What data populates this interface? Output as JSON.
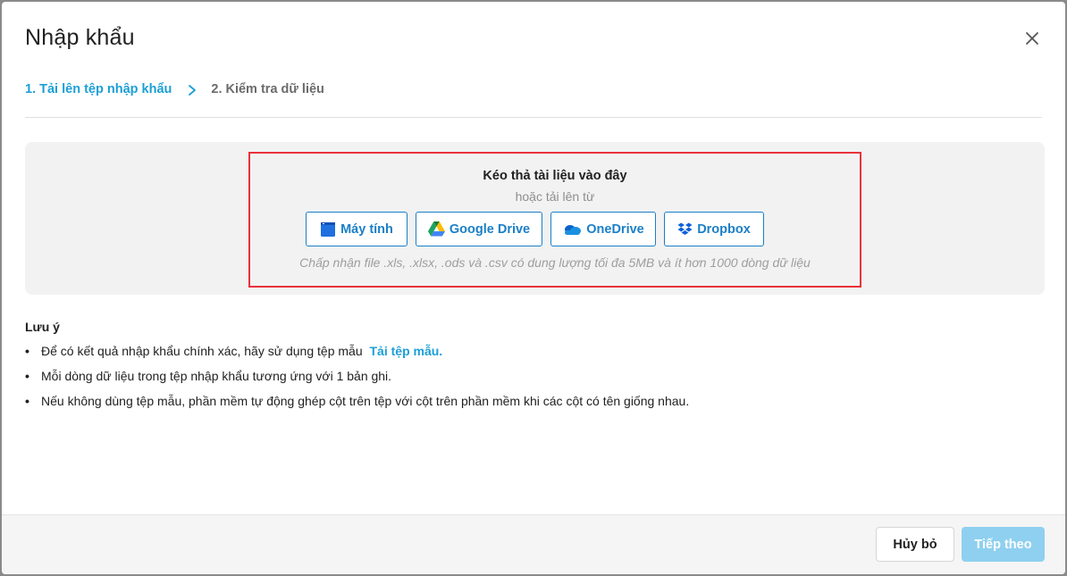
{
  "dialog": {
    "title": "Nhập khẩu",
    "close_icon": "close-icon"
  },
  "steps": [
    {
      "label": "1. Tải lên tệp nhập khẩu",
      "active": true
    },
    {
      "label": "2. Kiểm tra dữ liệu",
      "active": false
    }
  ],
  "upload": {
    "title": "Kéo thả tài liệu vào đây",
    "subtitle": "hoặc tải lên từ",
    "sources": [
      {
        "label": "Máy tính",
        "icon": "computer-icon"
      },
      {
        "label": "Google Drive",
        "icon": "google-drive-icon"
      },
      {
        "label": "OneDrive",
        "icon": "onedrive-icon"
      },
      {
        "label": "Dropbox",
        "icon": "dropbox-icon"
      }
    ],
    "accept_note": "Chấp nhận file .xls, .xlsx, .ods và .csv có dung lượng tối đa 5MB và ít hơn 1000 dòng dữ liệu"
  },
  "notes": {
    "title": "Lưu ý",
    "items": [
      {
        "text": "Để có kết quả nhập khẩu chính xác, hãy sử dụng tệp mẫu",
        "link": "Tải tệp mẫu."
      },
      {
        "text": "Mỗi dòng dữ liệu trong tệp nhập khẩu tương ứng với 1 bản ghi."
      },
      {
        "text": "Nếu không dùng tệp mẫu, phần mềm tự động ghép cột trên tệp với cột trên phần mềm khi các cột có tên giống nhau."
      }
    ]
  },
  "footer": {
    "cancel_label": "Hủy bỏ",
    "next_label": "Tiếp theo"
  },
  "colors": {
    "accent": "#1b9fd6",
    "highlight_border": "#e8323a",
    "next_disabled": "#8fd0f0"
  }
}
